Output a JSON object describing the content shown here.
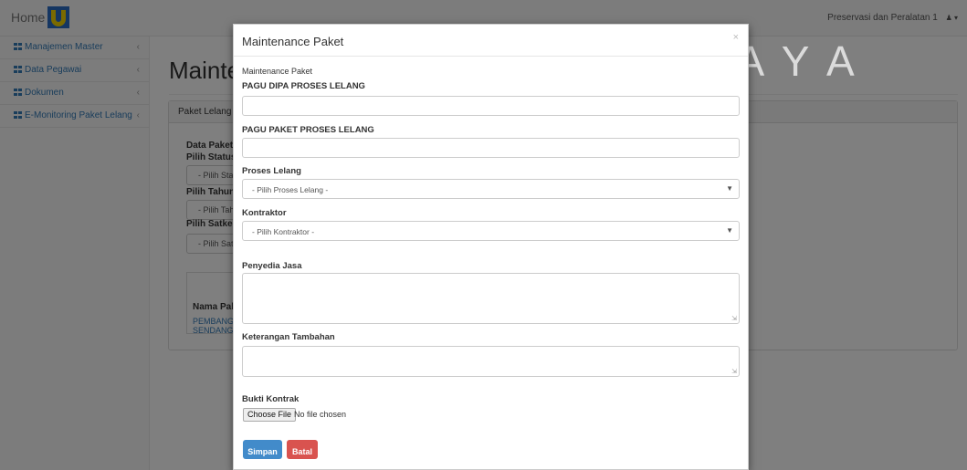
{
  "topbar": {
    "brand": "Home",
    "user_name": "Preservasi dan Peralatan 1"
  },
  "sidebar": {
    "items": [
      {
        "label": "Manajemen Master"
      },
      {
        "label": "Data Pegawai"
      },
      {
        "label": "Dokumen"
      },
      {
        "label": "E-Monitoring Paket Lelang"
      }
    ]
  },
  "background": {
    "page_title": "Mainte",
    "panel_title": "Paket Lelang",
    "data_paket": "Data Paket L",
    "pilih_status": "Pilih Status",
    "status_select": "- Pilih Statu",
    "pilih_tahun": "Pilih Tahun",
    "tahun_select": "- Pilih Tahu",
    "pilih_satker": "Pilih Satker",
    "satker_select": "- Pilih Satk",
    "table_header": "Nama Pake",
    "row_line1": "PEMBANGU",
    "row_line2": "SENDANGE"
  },
  "watermark": {
    "text": "SURABAYA"
  },
  "modal": {
    "title": "Maintenance Paket",
    "close": "×",
    "subtitle": "Maintenance Paket",
    "pagu_dipa_label": "PAGU DIPA PROSES LELANG",
    "pagu_paket_label": "PAGU PAKET PROSES LELANG",
    "proses_label": "Proses Lelang",
    "proses_selected": "- Pilih Proses Lelang -",
    "kontraktor_label": "Kontraktor",
    "kontraktor_selected": "- Pilih Kontraktor -",
    "penyedia_label": "Penyedia Jasa",
    "keterangan_label": "Keterangan Tambahan",
    "bukti_label": "Bukti Kontrak",
    "file_button": "Choose File",
    "file_status": "No file chosen",
    "save_label": "Simpan",
    "cancel_label": "Batal"
  },
  "colors": {
    "primary": "#428bca",
    "danger": "#d9534f",
    "link": "#337ab7"
  }
}
